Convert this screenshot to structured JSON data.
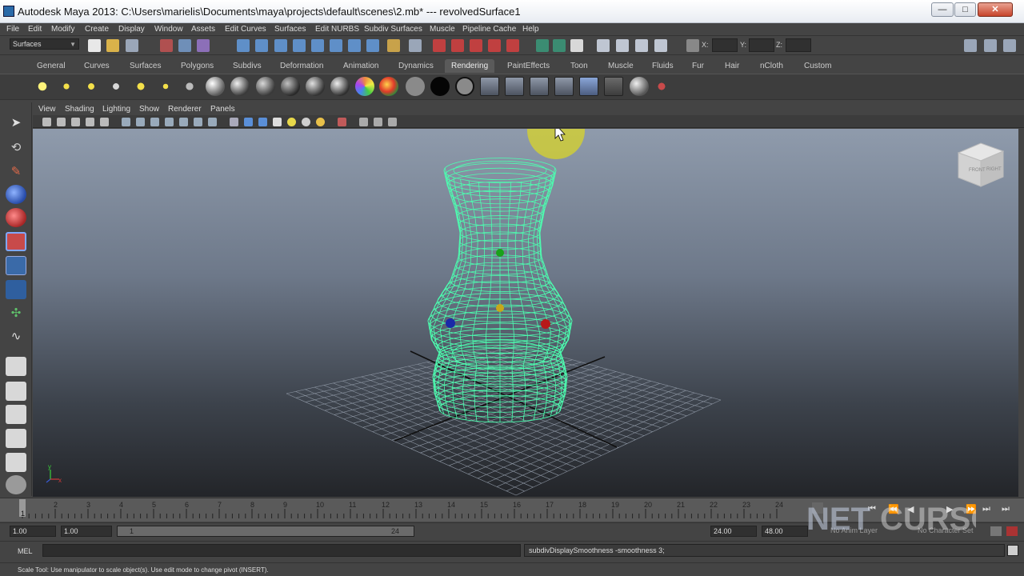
{
  "window": {
    "title": "Autodesk Maya 2013: C:\\Users\\marielis\\Documents\\maya\\projects\\default\\scenes\\2.mb*   ---   revolvedSurface1",
    "minimize": "—",
    "maximize": "□",
    "close": "✕"
  },
  "menus": [
    "File",
    "Edit",
    "Modify",
    "Create",
    "Display",
    "Window",
    "Assets",
    "Edit Curves",
    "Surfaces",
    "Edit NURBS",
    "Subdiv Surfaces",
    "Muscle",
    "Pipeline Cache",
    "Help"
  ],
  "status_line": {
    "mode": "Surfaces",
    "x_label": "X:",
    "y_label": "Y:",
    "z_label": "Z:"
  },
  "shelf_tabs": [
    "General",
    "Curves",
    "Surfaces",
    "Polygons",
    "Subdivs",
    "Deformation",
    "Animation",
    "Dynamics",
    "Rendering",
    "PaintEffects",
    "Toon",
    "Muscle",
    "Fluids",
    "Fur",
    "Hair",
    "nCloth",
    "Custom"
  ],
  "active_shelf_tab": "Rendering",
  "panel_menus": [
    "View",
    "Shading",
    "Lighting",
    "Show",
    "Renderer",
    "Panels"
  ],
  "viewcube": {
    "front": "FRONT",
    "right": "RIGHT"
  },
  "axis": {
    "x": "x",
    "y": "y",
    "z": "z"
  },
  "time_slider": {
    "ticks": [
      "1",
      "2",
      "3",
      "4",
      "5",
      "6",
      "7",
      "8",
      "9",
      "10",
      "11",
      "12",
      "13",
      "14",
      "15",
      "16",
      "17",
      "18",
      "19",
      "20",
      "21",
      "22",
      "23",
      "24"
    ],
    "current": "1"
  },
  "range": {
    "start": "1.00",
    "playback_start": "1.00",
    "slider_min": "1",
    "slider_max": "24",
    "playback_end": "24.00",
    "end": "48.00",
    "anim_layer": "No Anim Layer",
    "char_set": "No Character Set"
  },
  "command_line": {
    "label": "MEL",
    "input": "",
    "result": "subdivDisplaySmoothness -smoothness 3;"
  },
  "help_line": "Scale Tool: Use manipulator to scale object(s). Use edit mode to change pivot (INSERT).",
  "watermark": {
    "text1": "NET",
    "text2": "CURSO"
  },
  "colors": {
    "wire": "#4cffb0",
    "grid": "#8d96a3",
    "accent_active_tab": "#5a5a5a"
  }
}
